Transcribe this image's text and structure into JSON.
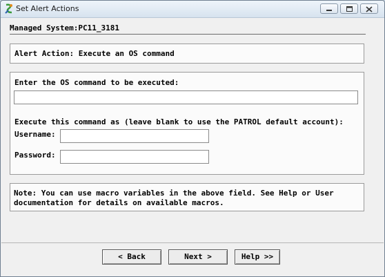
{
  "window": {
    "title": "Set Alert Actions",
    "controls": {
      "minimize_icon": "minimize-icon",
      "maximize_icon": "maximize-icon",
      "close_icon": "close-icon"
    }
  },
  "header": {
    "managed_system": "Managed System:PC11_3181"
  },
  "alert": {
    "action_label": "Alert Action: Execute an OS command"
  },
  "form": {
    "command_label": "Enter the OS command to be executed:",
    "command_value": "",
    "execute_as_label": "Execute this command as (leave blank to use the PATROL default account):",
    "username_label": "Username:",
    "username_value": "",
    "password_label": "Password:",
    "password_value": ""
  },
  "note": {
    "line1": "Note: You can use macro variables in the above field. See Help or User",
    "line2": "documentation for details on available macros."
  },
  "buttons": {
    "back": "< Back",
    "next": "Next >",
    "help": "Help >>"
  }
}
